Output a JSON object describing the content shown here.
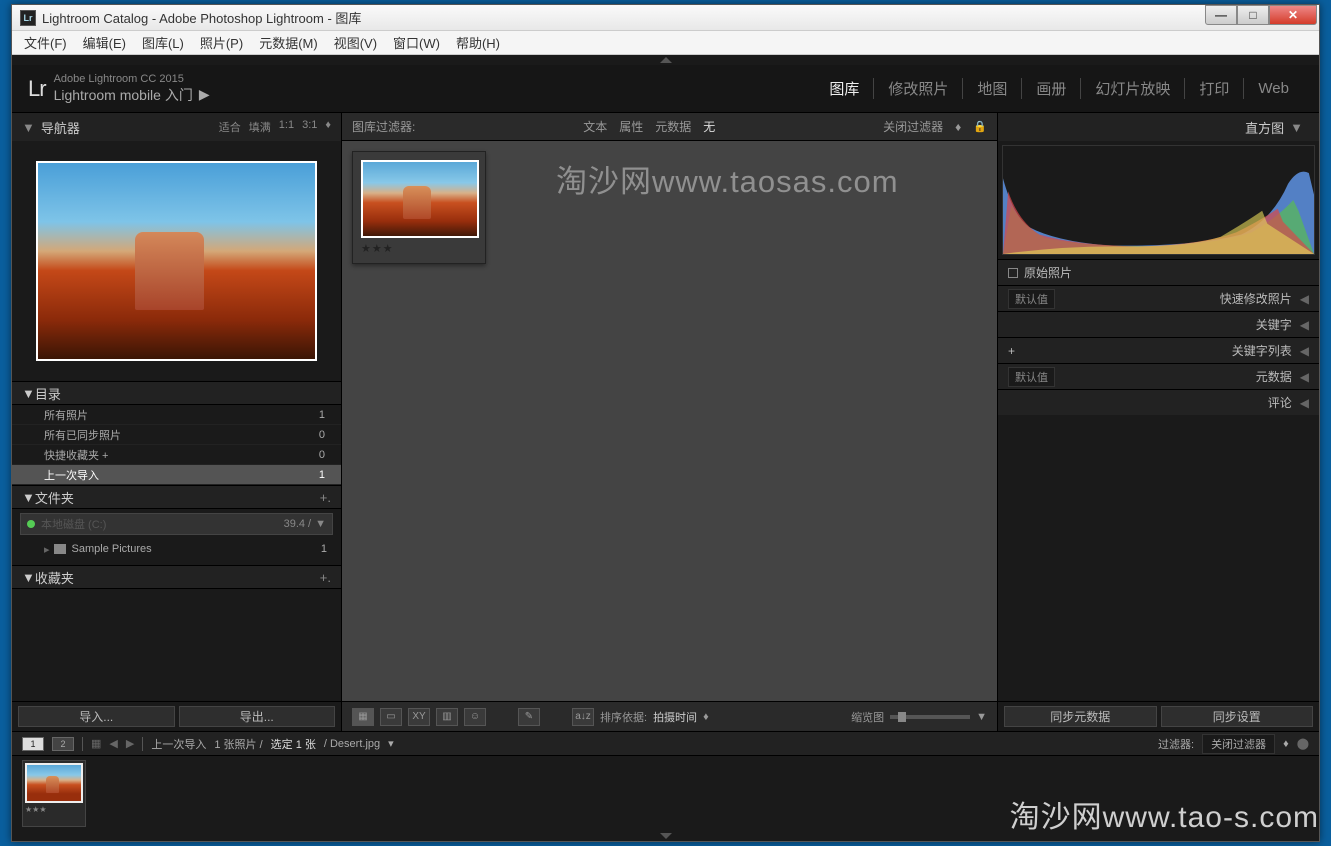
{
  "window": {
    "title": "Lightroom Catalog - Adobe Photoshop Lightroom - 图库"
  },
  "menubar": [
    "文件(F)",
    "编辑(E)",
    "图库(L)",
    "照片(P)",
    "元数据(M)",
    "视图(V)",
    "窗口(W)",
    "帮助(H)"
  ],
  "topbar": {
    "logo": "Lr",
    "brand": "Adobe Lightroom CC 2015",
    "subtitle": "Lightroom mobile 入门",
    "modules": [
      "图库",
      "修改照片",
      "地图",
      "画册",
      "幻灯片放映",
      "打印",
      "Web"
    ],
    "active_module": "图库"
  },
  "left": {
    "navigator": {
      "title": "导航器",
      "opts": [
        "适合",
        "填满",
        "1:1",
        "3:1"
      ]
    },
    "catalog": {
      "title": "目录",
      "items": [
        {
          "label": "所有照片",
          "count": "1"
        },
        {
          "label": "所有已同步照片",
          "count": "0"
        },
        {
          "label": "快捷收藏夹 +",
          "count": "0"
        },
        {
          "label": "上一次导入",
          "count": "1",
          "selected": true
        }
      ]
    },
    "folders": {
      "title": "文件夹",
      "volume": {
        "name": "本地磁盘 (C:)",
        "size": "39.4 /"
      },
      "items": [
        {
          "label": "Sample Pictures",
          "count": "1"
        }
      ]
    },
    "collections": {
      "title": "收藏夹"
    },
    "buttons": {
      "import": "导入...",
      "export": "导出..."
    }
  },
  "center": {
    "filter_label": "图库过滤器:",
    "filters": [
      "文本",
      "属性",
      "元数据",
      "无"
    ],
    "active_filter": "无",
    "close_filter": "关闭过滤器",
    "thumb_stars": "★★★",
    "toolbar": {
      "sort_label": "排序依据:",
      "sort_value": "拍摄时间",
      "zoom_label": "缩览图"
    }
  },
  "right": {
    "histogram_title": "直方图",
    "original": "原始照片",
    "rows": [
      {
        "left": "默认值",
        "label": "快速修改照片"
      },
      {
        "label": "关键字"
      },
      {
        "plus": "+",
        "label": "关键字列表"
      },
      {
        "left": "默认值",
        "label": "元数据"
      },
      {
        "label": "评论"
      }
    ],
    "sync_meta": "同步元数据",
    "sync_settings": "同步设置"
  },
  "footer": {
    "breadcrumb": "上一次导入",
    "count": "1 张照片 /",
    "selected": "选定 1 张",
    "filename": "/ Desert.jpg",
    "filter_label": "过滤器:",
    "filter_value": "关闭过滤器",
    "fs_stars": "★★★"
  },
  "watermarks": {
    "top": "淘沙网www.taosas.com",
    "bottom": "淘沙网www.tao-s.com"
  }
}
